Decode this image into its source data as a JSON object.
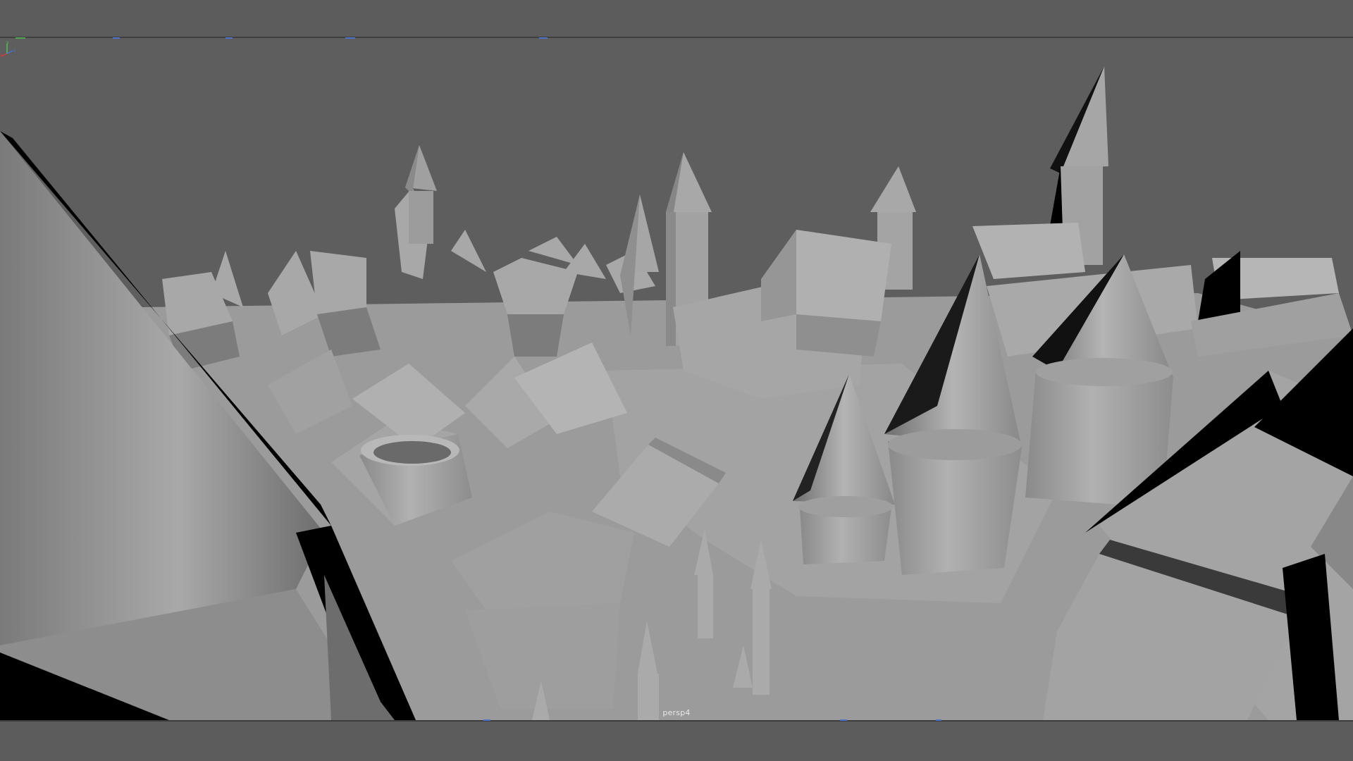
{
  "viewport": {
    "camera_name": "persp4",
    "background_color": "#5e5e5e",
    "shading_color": "#a9a9a9",
    "shadow_color": "#000000",
    "scene_description_icon": "3d-viewport"
  },
  "axis_gizmo": {
    "x_label": "x",
    "y_label": "y",
    "z_label": "z",
    "x_color": "#d23b3b",
    "y_color": "#4fc34f",
    "z_color": "#4a6fd1"
  },
  "colors": {
    "ui_background": "#5c5c5c",
    "divider": "#3f3f3f",
    "accent": "#4d72c7"
  }
}
